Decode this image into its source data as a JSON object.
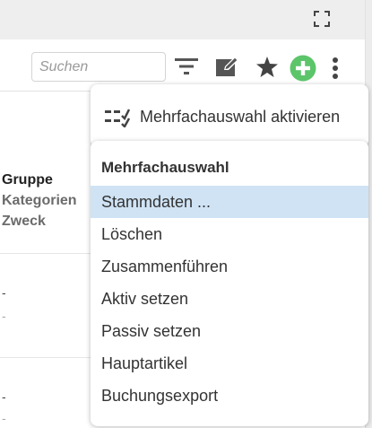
{
  "window": {
    "expand_icon": "expand-icon"
  },
  "toolbar": {
    "search_placeholder": "Suchen",
    "filter_icon": "filter-icon",
    "edit_icon": "edit-icon",
    "favorite_icon": "star-icon",
    "add_icon": "add-circle-icon",
    "more_icon": "more-vertical-icon",
    "add_color": "#5cc56a"
  },
  "table": {
    "header": {
      "line1": "Gruppe",
      "line2": "Kategorien",
      "line3": "Zweck"
    },
    "rows": [
      {
        "a": "-",
        "b": "-"
      },
      {
        "a": "-",
        "b": "-"
      }
    ]
  },
  "popup_toggle": {
    "icon": "multi-select-icon",
    "label": "Mehrfachauswahl aktivieren"
  },
  "menu": {
    "heading": "Mehrfachauswahl",
    "selected_color": "#cfe3f5",
    "items": [
      {
        "label": "Stammdaten ...",
        "selected": true
      },
      {
        "label": "Löschen",
        "selected": false
      },
      {
        "label": "Zusammenführen",
        "selected": false
      },
      {
        "label": "Aktiv setzen",
        "selected": false
      },
      {
        "label": "Passiv setzen",
        "selected": false
      },
      {
        "label": "Hauptartikel",
        "selected": false
      },
      {
        "label": "Buchungsexport",
        "selected": false
      }
    ]
  }
}
